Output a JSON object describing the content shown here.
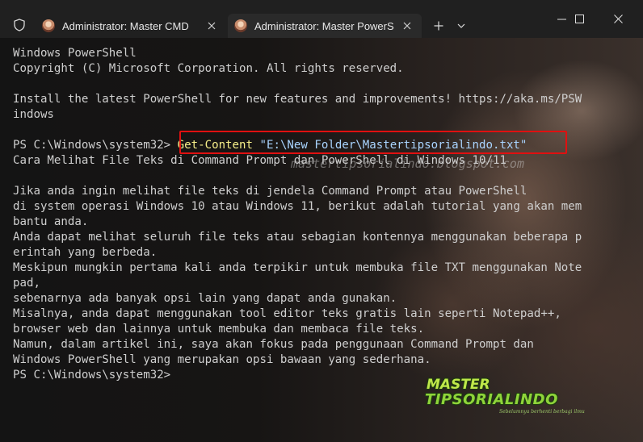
{
  "tabs": [
    {
      "title": "Administrator: Master CMD",
      "active": false
    },
    {
      "title": "Administrator: Master PowerS",
      "active": true
    }
  ],
  "icons": {
    "shield": "shield-icon",
    "close_tab": "close-icon",
    "new_tab": "plus-icon",
    "dropdown": "chevron-down-icon",
    "minimize": "minimize-icon",
    "maximize": "maximize-icon",
    "close_window": "close-icon"
  },
  "terminal": {
    "lines": [
      "Windows PowerShell",
      "Copyright (C) Microsoft Corporation. All rights reserved.",
      "",
      "Install the latest PowerShell for new features and improvements! https://aka.ms/PSW",
      "indows",
      "",
      "",
      "Cara Melihat File Teks di Command Prompt dan PowerShell di Windows 10/11",
      "",
      "Jika anda ingin melihat file teks di jendela Command Prompt atau PowerShell",
      "di system operasi Windows 10 atau Windows 11, berikut adalah tutorial yang akan mem",
      "bantu anda.",
      "Anda dapat melihat seluruh file teks atau sebagian kontennya menggunakan beberapa p",
      "erintah yang berbeda.",
      "Meskipun mungkin pertama kali anda terpikir untuk membuka file TXT menggunakan Note",
      "pad,",
      "sebenarnya ada banyak opsi lain yang dapat anda gunakan.",
      "Misalnya, anda dapat menggunakan tool editor teks gratis lain seperti Notepad++,",
      "browser web dan lainnya untuk membuka dan membaca file teks.",
      "Namun, dalam artikel ini, saya akan fokus pada penggunaan Command Prompt dan",
      "Windows PowerShell yang merupakan opsi bawaan yang sederhana.",
      "PS C:\\Windows\\system32>"
    ],
    "prompt": "PS C:\\Windows\\system32> ",
    "command": "Get-Content",
    "argument": " \"E:\\New Folder\\Mastertipsorialindo.txt\""
  },
  "watermark": {
    "url": "mastertipsorialindo.blogspot.com",
    "logo_top": "MASTER",
    "logo_bottom": "TIPSORIALINDO",
    "tagline": "Sebelumnya berhenti berbagi ilmu"
  },
  "colors": {
    "titlebar_bg": "#202020",
    "active_tab_bg": "#2a2a2a",
    "terminal_text": "#cfcfcf",
    "command_highlight": "#f6ef8a",
    "argument_highlight": "#a9d4ff",
    "annotation_box": "#e01010",
    "logo_green": "#8fd43a"
  }
}
